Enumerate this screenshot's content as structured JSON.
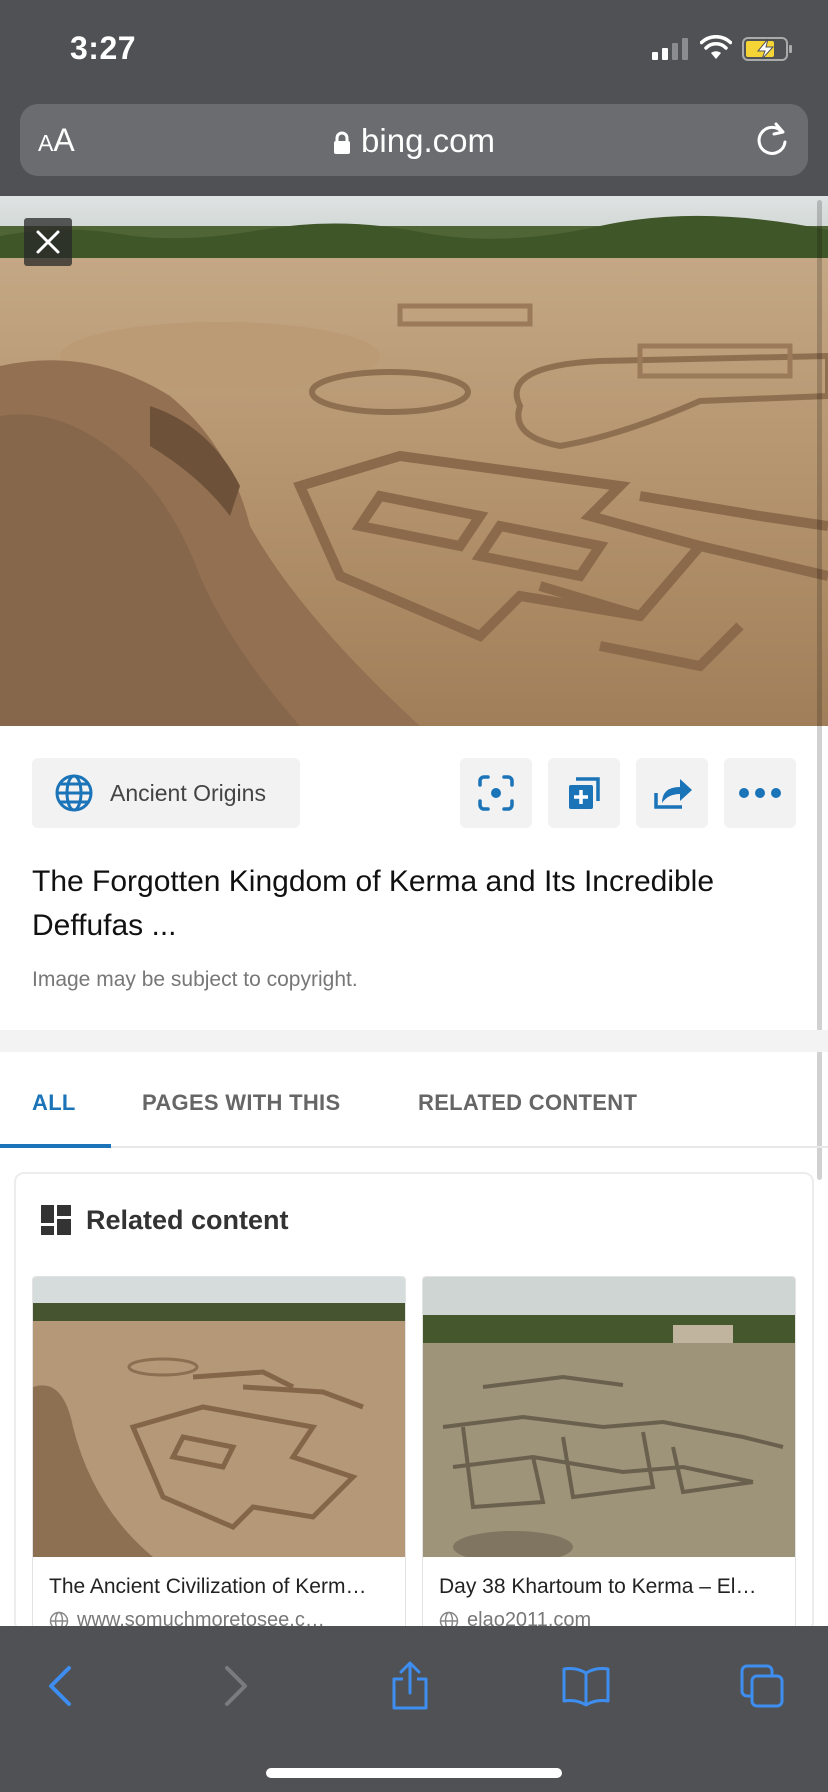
{
  "status_bar": {
    "time": "3:27"
  },
  "url_bar": {
    "text_size_label": "AA",
    "domain": "bing.com"
  },
  "source": {
    "name": "Ancient Origins"
  },
  "image": {
    "title": "The Forgotten Kingdom of Kerma and Its Incredible Deffufas ...",
    "copyright_note": "Image may be subject to copyright."
  },
  "tabs": [
    {
      "label": "ALL",
      "active": true
    },
    {
      "label": "PAGES WITH THIS",
      "active": false
    },
    {
      "label": "RELATED CONTENT",
      "active": false
    }
  ],
  "related": {
    "heading": "Related content",
    "items": [
      {
        "title": "The Ancient Civilization of Kerm…",
        "url": "www.somuchmoretosee.c…"
      },
      {
        "title": "Day 38 Khartoum to Kerma – El…",
        "url": "elao2011.com"
      }
    ]
  },
  "colors": {
    "accent": "#1b73b8",
    "chrome_gray": "#505154",
    "toolbar_icon_blue": "#3d8ef0"
  },
  "icons": {
    "close": "close-icon",
    "globe": "globe-icon",
    "visual_search": "visual-search-icon",
    "add_collection": "add-to-collection-icon",
    "share": "share-icon",
    "more": "more-icon",
    "back": "back-arrow-icon",
    "forward": "forward-arrow-icon",
    "safari_share": "share-icon",
    "bookmarks": "bookmarks-icon",
    "tabs": "tabs-icon"
  }
}
